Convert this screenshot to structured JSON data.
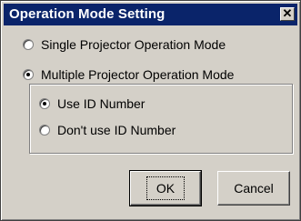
{
  "window": {
    "title": "Operation Mode Setting",
    "close_glyph": "✕"
  },
  "options": {
    "single": {
      "label": "Single Projector Operation Mode",
      "selected": false
    },
    "multiple": {
      "label": "Multiple Projector Operation Mode",
      "selected": true
    }
  },
  "id_options": {
    "use_id": {
      "label": "Use ID Number",
      "selected": true
    },
    "dont_use_id": {
      "label": "Don't use ID Number",
      "selected": false
    }
  },
  "buttons": {
    "ok": "OK",
    "cancel": "Cancel"
  },
  "colors": {
    "title_bar": "#0a246a",
    "dialog_bg": "#d4d0c8"
  }
}
